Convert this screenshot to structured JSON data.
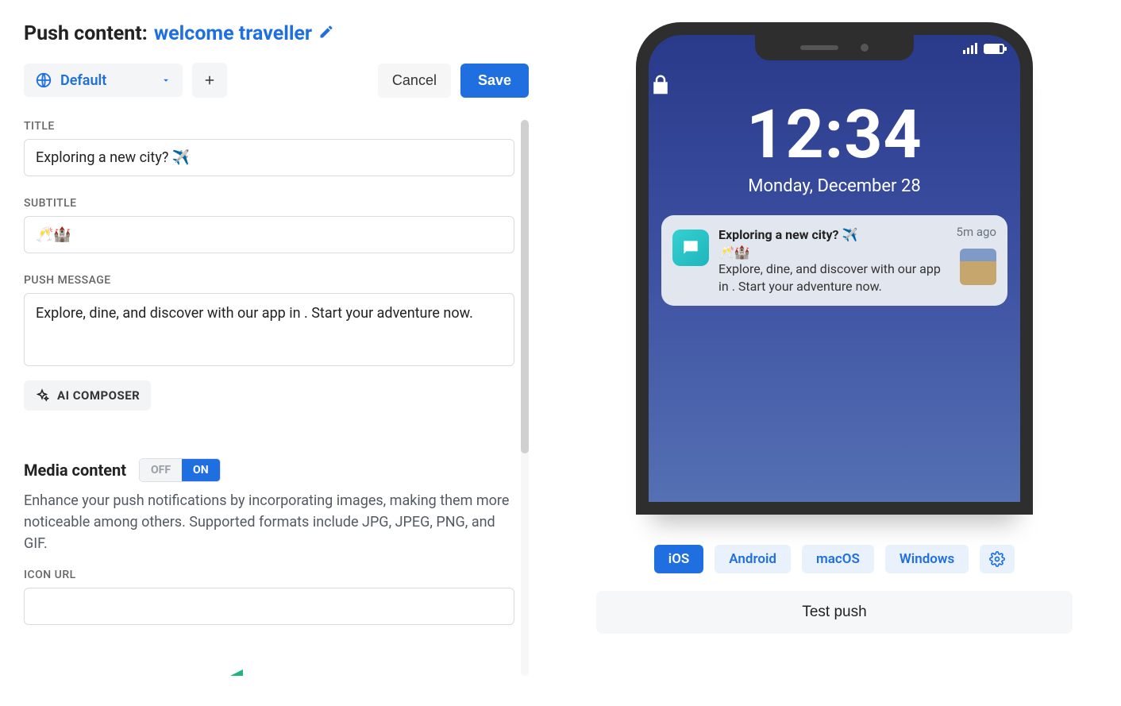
{
  "header": {
    "prefix": "Push content:",
    "name": "welcome traveller"
  },
  "toolbar": {
    "locale_label": "Default",
    "cancel_label": "Cancel",
    "save_label": "Save"
  },
  "fields": {
    "title_label": "TITLE",
    "title_value": "Exploring a new city? ✈️",
    "subtitle_label": "SUBTITLE",
    "subtitle_value": "🥂🏰",
    "message_label": "PUSH MESSAGE",
    "message_value": "Explore, dine, and discover with our app in . Start your adventure now.",
    "ai_composer_label": "AI COMPOSER"
  },
  "media": {
    "heading": "Media content",
    "toggle_off": "OFF",
    "toggle_on": "ON",
    "description": "Enhance your push notifications by incorporating images, making them more noticeable among others. Supported formats include JPG, JPEG, PNG, and GIF.",
    "icon_url_label": "ICON URL",
    "icon_url_value": ""
  },
  "preview": {
    "time": "12:34",
    "date": "Monday, December 28",
    "notif_time": "5m ago",
    "notif_title": "Exploring a new city? ✈️",
    "notif_subtitle": "🥂🏰",
    "notif_message": "Explore, dine, and discover with our app in . Start your adventure now."
  },
  "platforms": {
    "ios": "iOS",
    "android": "Android",
    "macos": "macOS",
    "windows": "Windows"
  },
  "actions": {
    "test_push": "Test push"
  }
}
